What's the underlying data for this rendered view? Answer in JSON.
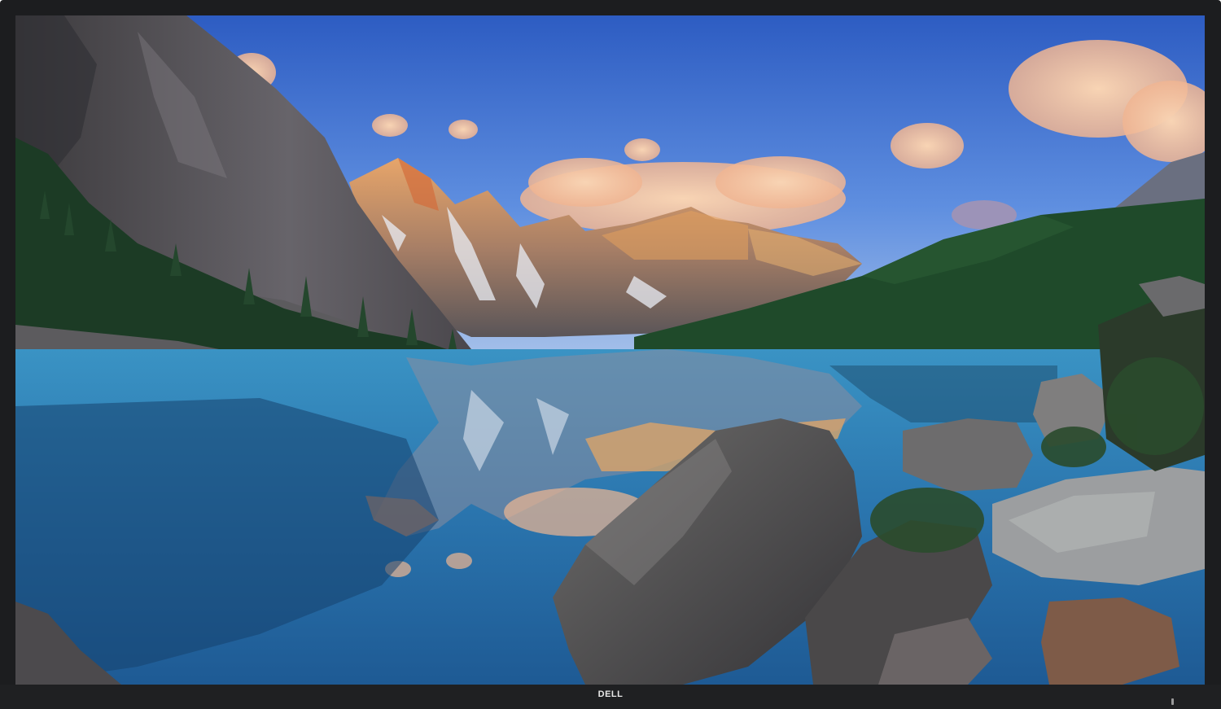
{
  "device": {
    "brand_logo_text": "DELL",
    "bezel_color": "#1c1d1f"
  },
  "wallpaper": {
    "subject": "mountain-lake-landscape",
    "colors": {
      "sky_top": "#2f5fc4",
      "sky_bottom": "#8fb2e6",
      "cloud": "#f2c4a3",
      "water": "#2e7fb3",
      "forest": "#1f4a2a",
      "rock": "#5a5a5e",
      "peak_glow": "#e8a060"
    }
  }
}
